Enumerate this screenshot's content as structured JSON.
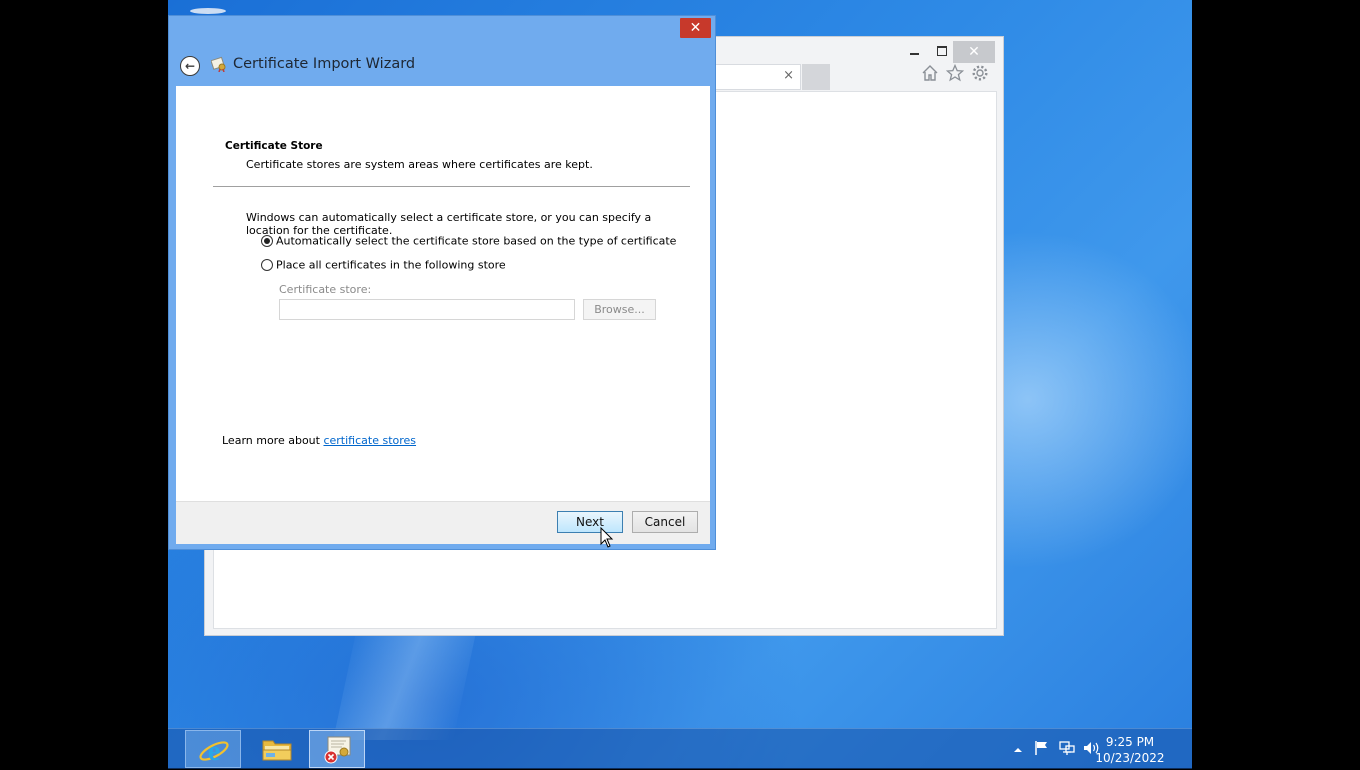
{
  "ie_window": {
    "controls": {
      "minimize": "minimize",
      "maximize": "maximize",
      "close": "✕"
    },
    "tab_close": "×",
    "toolbar_icons": [
      "home-icon",
      "star-icon",
      "gear-icon"
    ]
  },
  "wizard": {
    "title": "Certificate Import Wizard",
    "close_glyph": "✕",
    "back_glyph": "←",
    "heading": "Certificate Store",
    "subheading": "Certificate stores are system areas where certificates are kept.",
    "description": "Windows can automatically select a certificate store, or you can specify a location for the certificate.",
    "options": [
      {
        "label": "Automatically select the certificate store based on the type of certificate",
        "selected": true
      },
      {
        "label": "Place all certificates in the following store",
        "selected": false
      }
    ],
    "store_label": "Certificate store:",
    "store_value": "",
    "browse_label": "Browse...",
    "learn_more_prefix": "Learn more about ",
    "learn_more_link": "certificate stores",
    "next_label": "Next",
    "cancel_label": "Cancel"
  },
  "taskbar": {
    "apps": [
      "internet-explorer",
      "file-explorer",
      "certificate-import"
    ],
    "tray_icons": [
      "chevron-up-icon",
      "flag-icon",
      "network-icon",
      "volume-icon"
    ],
    "time": "9:25 PM",
    "date": "10/23/2022"
  },
  "colors": {
    "accent": "#70abee",
    "close_red": "#c7392b",
    "link": "#0066cc"
  }
}
